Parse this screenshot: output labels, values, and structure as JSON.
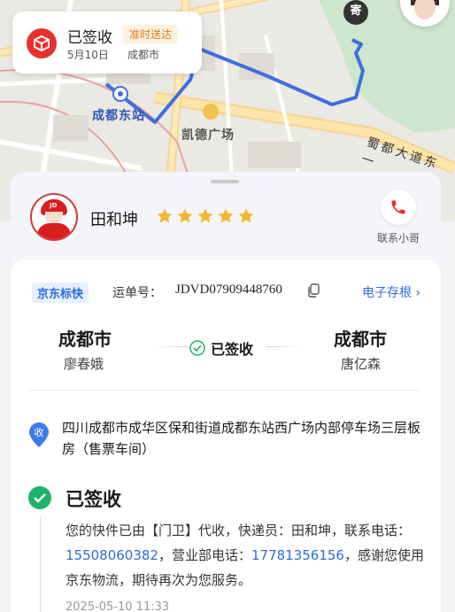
{
  "status": {
    "title": "已签收",
    "badge": "准时送达",
    "date": "5月10日",
    "city": "成都市"
  },
  "map": {
    "station_label": "成都东站",
    "plaza_label": "凯德广场",
    "road_label": "蜀都大道东一",
    "pin_label": "寄",
    "route_color": "#3d6fe0"
  },
  "courier": {
    "name": "田和坤",
    "rating": 5,
    "contact_label": "联系小哥"
  },
  "shipment": {
    "brand": "京东标快",
    "waybill_label": "运单号：",
    "waybill_number": "JDVD07909448760",
    "archive_label": "电子存根",
    "from_city": "成都市",
    "from_name": "廖春娥",
    "status": "已签收",
    "to_city": "成都市",
    "to_name": "唐亿森"
  },
  "address": {
    "icon_text": "收",
    "text": "四川成都市成华区保和街道成都东站西广场内部停车场三层板房（售票车间）"
  },
  "event": {
    "title": "已签收",
    "desc_1": "您的快件已由【门卫】代收，快递员：田和坤，联系电话：",
    "phone_1": "15508060382",
    "desc_2": "，营业部电话：",
    "phone_2": "17781356156",
    "desc_3": "，感谢您使用京东物流，期待再次为您服务。",
    "time": "2025-05-10 11:33"
  },
  "colors": {
    "accent": "#e8302c",
    "link": "#2e6bd8",
    "success": "#1db36b",
    "star": "#f5b731"
  }
}
